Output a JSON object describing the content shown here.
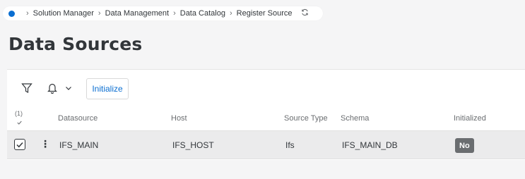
{
  "breadcrumb": {
    "items": [
      "Solution Manager",
      "Data Management",
      "Data Catalog",
      "Register Source"
    ]
  },
  "page": {
    "title": "Data Sources"
  },
  "toolbar": {
    "initialize_label": "Initialize"
  },
  "table": {
    "selection_count": "(1)",
    "columns": {
      "datasource": "Datasource",
      "host": "Host",
      "source_type": "Source Type",
      "schema": "Schema",
      "initialized": "Initialized"
    },
    "rows": [
      {
        "datasource": "IFS_MAIN",
        "host": "IFS_HOST",
        "source_type": "Ifs",
        "schema": "IFS_MAIN_DB",
        "initialized": "No",
        "selected": true
      }
    ]
  },
  "colors": {
    "accent": "#0a6ed1",
    "badge_bg": "#6a6d70",
    "selected_row_bg": "#ebebec"
  },
  "icons": [
    "home-dot-icon",
    "chevron-right-icon",
    "refresh-icon",
    "filter-icon",
    "bell-icon",
    "chevron-down-icon",
    "checkbox-icon",
    "more-vertical-icon"
  ]
}
